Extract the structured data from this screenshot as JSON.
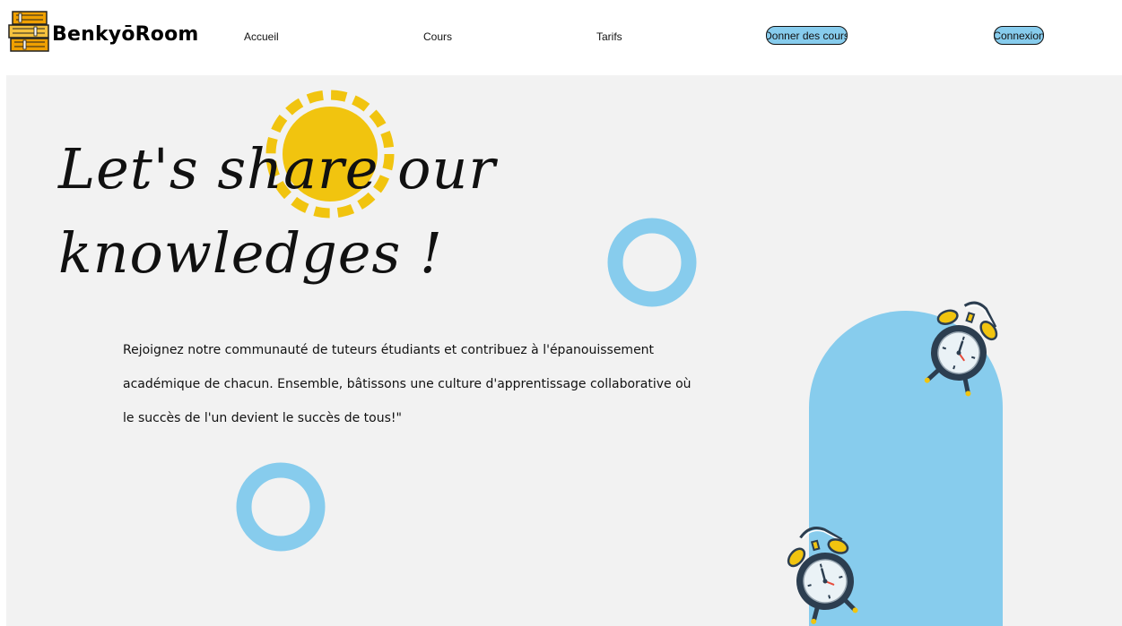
{
  "brand": {
    "name": "BenkyōRoom",
    "logo_icon": "books-stack-icon"
  },
  "nav": {
    "links": [
      "Accueil",
      "Cours",
      "Tarifs"
    ],
    "teach_button": "Donner des cours",
    "login_button": "Connexion"
  },
  "hero": {
    "headline_line1": "Let's share our",
    "headline_line2": "knowledges !",
    "intro": "Rejoignez notre communauté de tuteurs étudiants et contribuez à l'épanouissement académique de chacun. Ensemble, bâtissons une culture d'apprentissage collaborative où le succès de l'un devient le succès de tous!\""
  },
  "colors": {
    "accent_blue": "#87cced",
    "sun_yellow": "#f1c40f",
    "clock_dark": "#2c3e50",
    "background": "#f2f2f2"
  },
  "icons": [
    "sun-icon",
    "ring-shape",
    "alarm-clock-icon"
  ]
}
